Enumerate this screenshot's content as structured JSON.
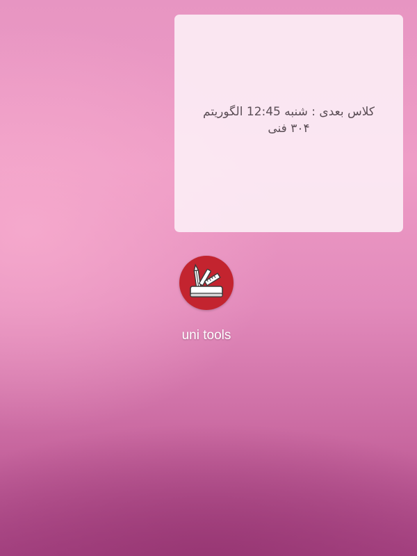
{
  "widget": {
    "line1": "کلاس بعدی : شنبه 12:45 الگوریتم",
    "line2": "۳۰۴ فنی"
  },
  "app": {
    "label": "uni tools",
    "icon": "pencil-ruler-toolkit-icon",
    "icon_color": "#c3242f"
  }
}
